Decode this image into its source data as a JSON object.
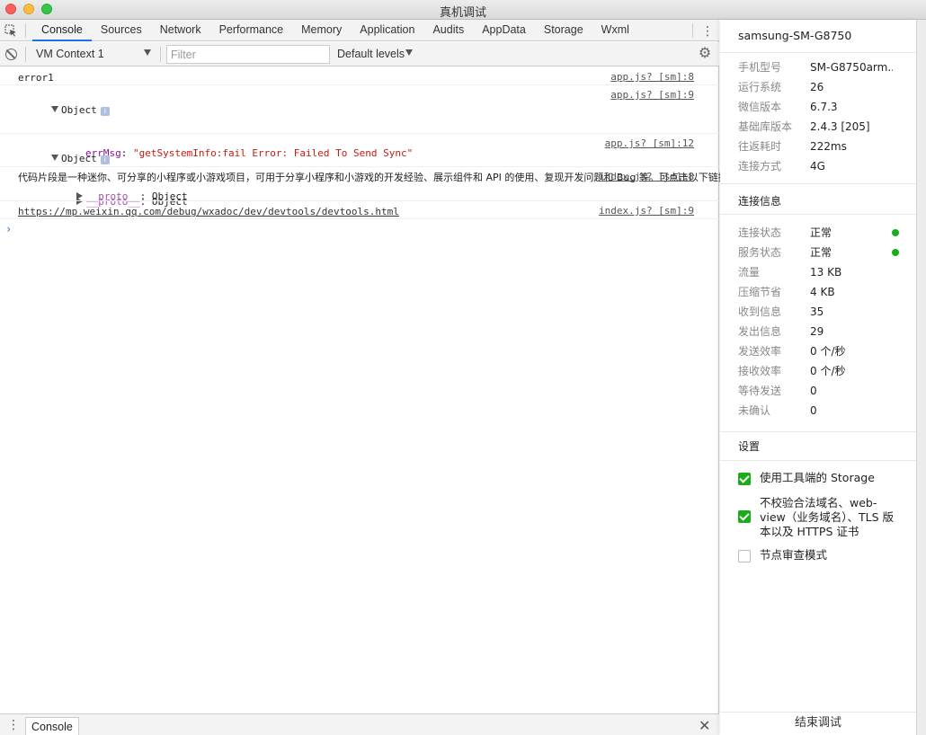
{
  "window": {
    "title": "真机调试"
  },
  "tabs": [
    "Console",
    "Sources",
    "Network",
    "Performance",
    "Memory",
    "Application",
    "Audits",
    "AppData",
    "Storage",
    "Wxml"
  ],
  "active_tab": "Console",
  "toolbar": {
    "context": "VM Context 1",
    "filter_placeholder": "Filter",
    "levels": "Default levels"
  },
  "console": {
    "messages": [
      {
        "text": "error1",
        "source": "app.js? [sm]:8"
      },
      {
        "obj_label": "Object",
        "err_key": "errMsg",
        "err_value": "\"getSystemInfo:fail Error: Failed To Send Sync\"",
        "proto_key": "__proto__",
        "proto_value": "Object",
        "source": "app.js? [sm]:9"
      },
      {
        "obj_label": "Object",
        "proto_key": "__proto__",
        "proto_value": "Object",
        "source": "app.js? [sm]:12"
      },
      {
        "text": "代码片段是一种迷你、可分享的小程序或小游戏项目，可用于分享小程序和小游戏的开发经验、展示组件和 API 的使用、复现开发问题和 Bug 等。可点击以下链接查看代码片段的详细文档：",
        "source": "index.js? [sm]:8"
      },
      {
        "text": "https://mp.weixin.qq.com/debug/wxadoc/dev/devtools/devtools.html",
        "source": "index.js? [sm]:9"
      }
    ],
    "prompt": "›"
  },
  "drawer": {
    "tab": "Console"
  },
  "panel": {
    "device": "samsung-SM-G8750",
    "info": [
      {
        "k": "手机型号",
        "v": "SM-G8750arm..."
      },
      {
        "k": "运行系统",
        "v": "26"
      },
      {
        "k": "微信版本",
        "v": "6.7.3"
      },
      {
        "k": "基础库版本",
        "v": "2.4.3 [205]"
      },
      {
        "k": "往返耗时",
        "v": "222ms"
      },
      {
        "k": "连接方式",
        "v": "4G"
      }
    ],
    "conn_title": "连接信息",
    "conn": [
      {
        "k": "连接状态",
        "v": "正常",
        "dot": true
      },
      {
        "k": "服务状态",
        "v": "正常",
        "dot": true
      },
      {
        "k": "流量",
        "v": "13 KB"
      },
      {
        "k": "压缩节省",
        "v": "4 KB"
      },
      {
        "k": "收到信息",
        "v": "35"
      },
      {
        "k": "发出信息",
        "v": "29"
      },
      {
        "k": "发送效率",
        "v": "0 个/秒"
      },
      {
        "k": "接收效率",
        "v": "0 个/秒"
      },
      {
        "k": "等待发送",
        "v": "0"
      },
      {
        "k": "未确认",
        "v": "0"
      }
    ],
    "settings_title": "设置",
    "settings": [
      {
        "label": "使用工具端的 Storage",
        "checked": true
      },
      {
        "label": "不校验合法域名、web-view（业务域名）、TLS 版本以及 HTTPS 证书",
        "checked": true
      },
      {
        "label": "节点审查模式",
        "checked": false
      }
    ],
    "stop_button": "结束调试"
  },
  "colors": {
    "accent": "#1a73e8",
    "ok": "#1aad19",
    "string": "#c41a16",
    "key": "#881391"
  }
}
